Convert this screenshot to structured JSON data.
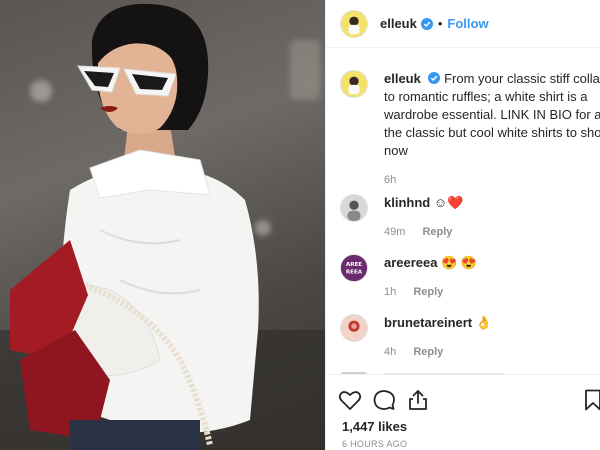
{
  "post": {
    "username": "elleuk",
    "follow_label": "Follow",
    "separator": "•"
  },
  "caption": {
    "username": "elleuk",
    "text": "From your classic stiff collar, to romantic ruffles; a white shirt is a wardrobe essential. LINK IN BIO for all the classic but cool white shirts to shop now",
    "time": "6h"
  },
  "comments": [
    {
      "username": "klinhnd",
      "text": "☺❤️",
      "time": "49m",
      "reply_label": "Reply"
    },
    {
      "username": "areereea",
      "text": "😍 😍",
      "time": "1h",
      "reply_label": "Reply",
      "avatar_text": "AREE REEA"
    },
    {
      "username": "brunetareinert",
      "text": "👌",
      "time": "4h",
      "reply_label": "Reply"
    }
  ],
  "engagement": {
    "likes": "1,447 likes",
    "timestamp": "6 HOURS AGO"
  },
  "icons": {
    "verified": "verified-badge-icon",
    "like": "heart-icon",
    "comment": "comment-bubble-icon",
    "share": "share-icon",
    "save": "bookmark-icon"
  },
  "colors": {
    "link_blue": "#3897f0",
    "verified_blue": "#3897f0",
    "muted_text": "#8e8e8e",
    "text": "#262626",
    "elle_yellow": "#f2e26a"
  }
}
